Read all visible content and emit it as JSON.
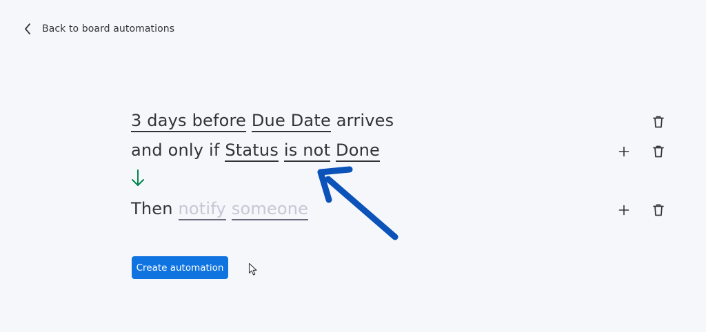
{
  "header": {
    "back_label": "Back to board automations",
    "back_icon": "chevron-left-icon"
  },
  "recipe": {
    "trigger": {
      "amount": "3 days before",
      "column": "Due Date",
      "suffix": "arrives"
    },
    "condition": {
      "prefix": "and only if",
      "column": "Status",
      "operator": "is not",
      "value": "Done"
    },
    "action": {
      "prefix": "Then",
      "verb": "notify",
      "target": "someone"
    }
  },
  "footer": {
    "create_label": "Create automation"
  },
  "icons": {
    "delete": "trash-icon",
    "add": "plus-icon",
    "flow": "arrow-down-icon",
    "annotation": "blue-annotation-arrow-icon",
    "cursor": "mouse-pointer-icon"
  },
  "colors": {
    "background": "#f6f7fb",
    "text": "#323338",
    "placeholder": "#c5c7d4",
    "primary_button": "#0f73e0",
    "flow_arrow": "#00854d",
    "annotation": "#0b52b9"
  }
}
